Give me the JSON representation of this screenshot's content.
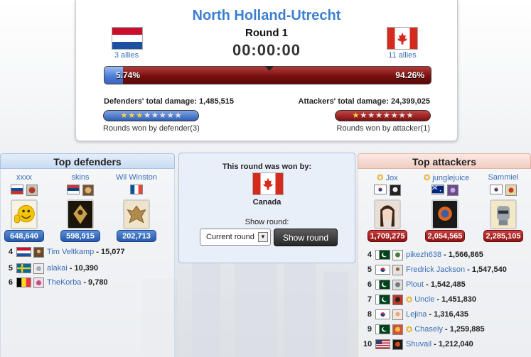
{
  "battle": {
    "title": "North Holland-Utrecht",
    "round": "Round 1",
    "timer": "00:00:00",
    "defender_allies": "3 allies",
    "attacker_allies": "11 allies",
    "defender_percent_label": "5.74%",
    "attacker_percent_label": "94.26%",
    "defender_percent": 5.74,
    "defender_damage_label": "Defenders' total damage:",
    "defender_damage": "1,485,515",
    "attacker_damage_label": "Attackers' total damage:",
    "attacker_damage": "24,399,025",
    "defender_rounds_label": "Rounds won by defender(3)",
    "attacker_rounds_label": "Rounds won by attacker(1)",
    "defender_stars_won": 3,
    "attacker_stars_won": 1,
    "stars_total": 8
  },
  "defenders": {
    "header": "Top defenders",
    "top": [
      {
        "name": "xxxx",
        "damage": "648,640",
        "flag": "slovenia"
      },
      {
        "name": "skins",
        "damage": "598,915",
        "flag": "serbia"
      },
      {
        "name": "Wil Winston",
        "damage": "202,713",
        "flag": "france"
      }
    ],
    "list": [
      {
        "rank": "4",
        "name": "Tim Veltkamp",
        "damage": "15,077",
        "flag": "netherlands"
      },
      {
        "rank": "5",
        "name": "alakai",
        "damage": "10,390",
        "flag": "sweden"
      },
      {
        "rank": "6",
        "name": "TheKorba",
        "damage": "9,780",
        "flag": "belgium"
      }
    ]
  },
  "middle": {
    "won_by": "This round was won by:",
    "winner": "Canada",
    "show_round_label": "Show round:",
    "select_value": "Current round",
    "button": "Show round"
  },
  "attackers": {
    "header": "Top attackers",
    "top": [
      {
        "name": "Jox",
        "damage": "1,709,275",
        "flag": "south-korea"
      },
      {
        "name": "junglejuice",
        "damage": "2,054,565",
        "flag": "australia"
      },
      {
        "name": "Sammiel",
        "damage": "2,285,105",
        "flag": "south-korea"
      }
    ],
    "list": [
      {
        "rank": "4",
        "name": "pikezh638",
        "damage": "1,566,865",
        "flag": "pakistan"
      },
      {
        "rank": "5",
        "name": "Fredrick Jackson",
        "damage": "1,547,540",
        "flag": "south-korea"
      },
      {
        "rank": "6",
        "name": "Plout",
        "damage": "1,542,485",
        "flag": "pakistan"
      },
      {
        "rank": "7",
        "name": "Uncle",
        "damage": "1,451,830",
        "flag": "pakistan"
      },
      {
        "rank": "8",
        "name": "Lejina",
        "damage": "1,316,435",
        "flag": "south-korea"
      },
      {
        "rank": "9",
        "name": "Chasely",
        "damage": "1,259,885",
        "flag": "pakistan"
      },
      {
        "rank": "10",
        "name": "Shuvail",
        "damage": "1,212,040",
        "flag": "usa"
      }
    ]
  },
  "colors": {
    "title_blue": "#3c7fd1",
    "defender_blue": "#2558a8",
    "attacker_red": "#8e1414",
    "link_blue": "#3b6fb6"
  }
}
